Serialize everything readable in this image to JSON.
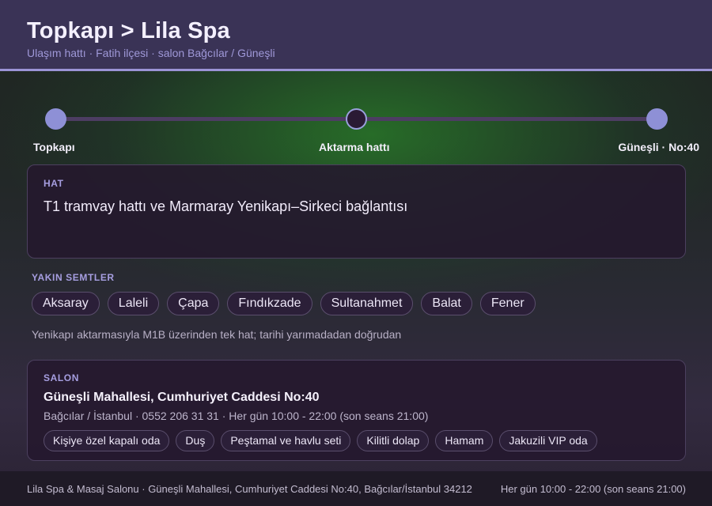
{
  "header": {
    "title": "Topkapı > Lila Spa",
    "subtitle": "Ulaşım hattı · Fatih ilçesi · salon Bağcılar / Güneşli"
  },
  "route": {
    "stops": [
      "Topkapı",
      "Aktarma hattı",
      "Güneşli · No:40"
    ]
  },
  "hat": {
    "label": "HAT",
    "value": "T1 tramvay hattı ve Marmaray Yenikapı–Sirkeci bağlantısı"
  },
  "semtler": {
    "label": "YAKIN SEMTLER",
    "items": [
      "Aksaray",
      "Laleli",
      "Çapa",
      "Fındıkzade",
      "Sultanahmet",
      "Balat",
      "Fener"
    ],
    "note": "Yenikapı aktarmasıyla M1B üzerinden tek hat; tarihi yarımadadan doğrudan"
  },
  "salon": {
    "label": "SALON",
    "address": "Güneşli Mahallesi, Cumhuriyet Caddesi No:40",
    "meta": "Bağcılar / İstanbul · 0552 206 31 31 · Her gün 10:00 - 22:00 (son seans 21:00)",
    "amenities": [
      "Kişiye özel kapalı oda",
      "Duş",
      "Peştamal ve havlu seti",
      "Kilitli dolap",
      "Hamam",
      "Jakuzili VIP oda"
    ]
  },
  "footer": {
    "left": "Lila Spa & Masaj Salonu · Güneşli Mahallesi, Cumhuriyet Caddesi No:40, Bağcılar/İstanbul 34212",
    "right": "Her gün 10:00 - 22:00 (son seans 21:00)"
  },
  "colors": {
    "accent": "#9b93d6",
    "header_bg": "#3a3356",
    "card_bg": "#24182e"
  }
}
